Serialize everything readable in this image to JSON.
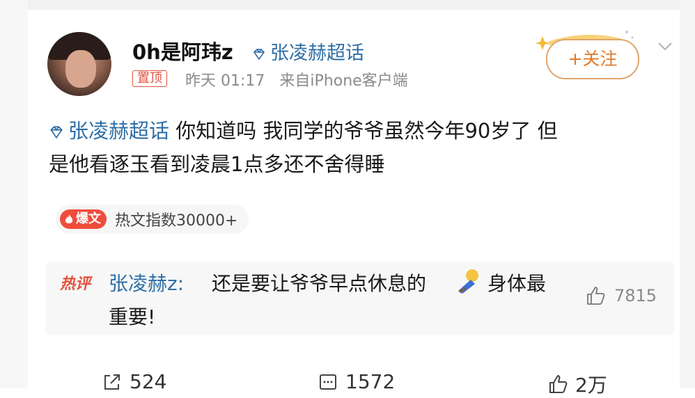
{
  "user": {
    "name": "0h是阿玮z",
    "avatar_icon": "user-avatar"
  },
  "topic_link": {
    "label": "张凌赫超话",
    "icon": "diamond-gem-icon",
    "color": "#2e6ea6"
  },
  "meta": {
    "pin_label": "置顶",
    "time": "昨天 01:17",
    "source": "来自iPhone客户端"
  },
  "follow": {
    "label": "+关注",
    "accent": "#e07a2a"
  },
  "post": {
    "topic": "张凌赫超话",
    "text_line1": " 你知道吗 我同学的爷爷虽然今年90岁了 但",
    "text_line2": "是他看逐玉看到凌晨1点多还不舍得睡"
  },
  "hot": {
    "tag": "爆文",
    "text": "热文指数30000+"
  },
  "comment": {
    "label": "热评",
    "user": "张凌赫z:",
    "text1": " 还是要让爷爷早点休息的",
    "text2": "身体最",
    "text3": "重要!",
    "likes": "7815"
  },
  "actions": {
    "reposts": "524",
    "comments": "1572",
    "likes": "2万"
  }
}
